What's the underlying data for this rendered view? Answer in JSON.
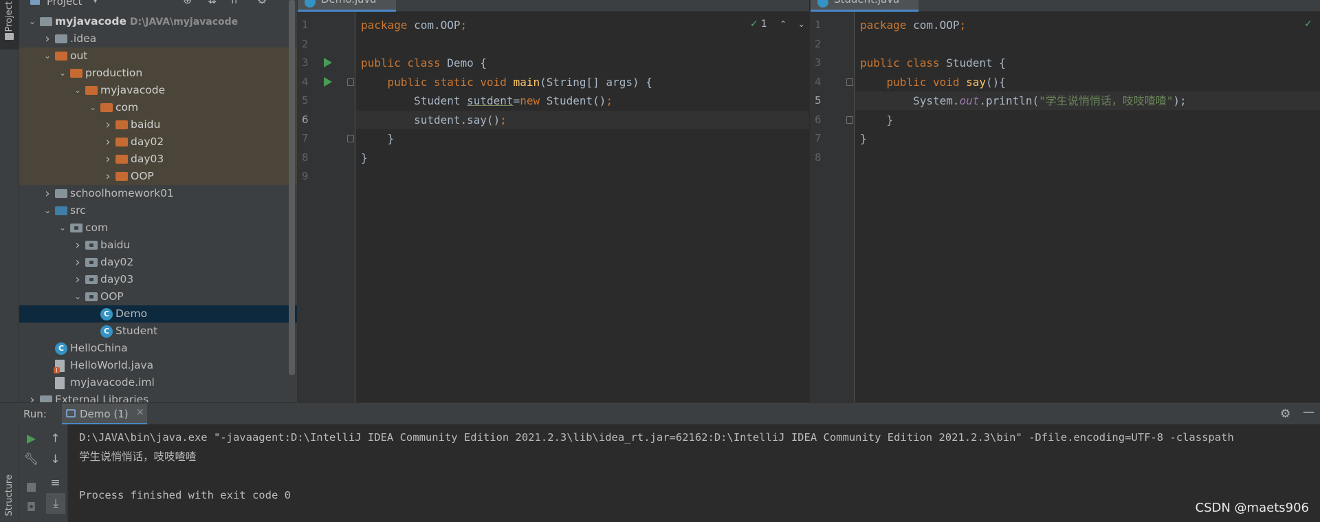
{
  "left_strip": {
    "project_tab": "Project",
    "structure_tab": "Structure"
  },
  "project_panel": {
    "title": "Project",
    "tree": [
      {
        "label": "myjavacode",
        "path": "D:\\JAVA\\myjavacode",
        "kind": "module",
        "state": "expanded",
        "bold": true
      },
      {
        "label": ".idea",
        "kind": "folder-grey",
        "state": "collapsed"
      },
      {
        "label": "out",
        "kind": "folder-orange",
        "state": "expanded"
      },
      {
        "label": "production",
        "kind": "folder-orange",
        "state": "expanded"
      },
      {
        "label": "myjavacode",
        "kind": "folder-orange",
        "state": "expanded"
      },
      {
        "label": "com",
        "kind": "folder-orange",
        "state": "expanded"
      },
      {
        "label": "baidu",
        "kind": "folder-orange",
        "state": "collapsed"
      },
      {
        "label": "day02",
        "kind": "folder-orange",
        "state": "collapsed"
      },
      {
        "label": "day03",
        "kind": "folder-orange",
        "state": "collapsed"
      },
      {
        "label": "OOP",
        "kind": "folder-orange",
        "state": "collapsed"
      },
      {
        "label": "schoolhomework01",
        "kind": "folder-grey",
        "state": "collapsed"
      },
      {
        "label": "src",
        "kind": "folder-blue",
        "state": "expanded"
      },
      {
        "label": "com",
        "kind": "package",
        "state": "expanded"
      },
      {
        "label": "baidu",
        "kind": "package",
        "state": "collapsed"
      },
      {
        "label": "day02",
        "kind": "package",
        "state": "collapsed"
      },
      {
        "label": "day03",
        "kind": "package",
        "state": "collapsed"
      },
      {
        "label": "OOP",
        "kind": "package",
        "state": "expanded"
      },
      {
        "label": "Demo",
        "kind": "class-runnable",
        "selected": true
      },
      {
        "label": "Student",
        "kind": "class"
      },
      {
        "label": "HelloChina",
        "kind": "class-runnable"
      },
      {
        "label": "HelloWorld.java",
        "kind": "java-file"
      },
      {
        "label": "myjavacode.iml",
        "kind": "iml-file"
      },
      {
        "label": "External Libraries",
        "kind": "libraries",
        "state": "collapsed"
      }
    ]
  },
  "editor_left": {
    "tab": "Demo.java",
    "inspection": {
      "count": "1"
    },
    "current_line": 6,
    "line_numbers": [
      "1",
      "2",
      "3",
      "4",
      "5",
      "6",
      "7",
      "8",
      "9"
    ],
    "lines": [
      {
        "parts": [
          {
            "t": "package ",
            "c": "kw"
          },
          {
            "t": "com.OOP",
            "c": ""
          },
          {
            "t": ";",
            "c": "kw"
          }
        ]
      },
      {
        "parts": []
      },
      {
        "parts": [
          {
            "t": "public class ",
            "c": "kw"
          },
          {
            "t": "Demo {",
            "c": ""
          }
        ]
      },
      {
        "parts": [
          {
            "t": "    public static void ",
            "c": "kw"
          },
          {
            "t": "main",
            "c": "fn"
          },
          {
            "t": "(String[] args) {",
            "c": ""
          }
        ]
      },
      {
        "parts": [
          {
            "t": "        Student ",
            "c": ""
          },
          {
            "t": "sutdent",
            "c": "uline"
          },
          {
            "t": "=",
            "c": ""
          },
          {
            "t": "new ",
            "c": "kw"
          },
          {
            "t": "Student()",
            "c": ""
          },
          {
            "t": ";",
            "c": "kw"
          }
        ]
      },
      {
        "parts": [
          {
            "t": "        sutdent.say()",
            "c": ""
          },
          {
            "t": ";",
            "c": "kw"
          }
        ]
      },
      {
        "parts": [
          {
            "t": "    }",
            "c": ""
          }
        ]
      },
      {
        "parts": [
          {
            "t": "}",
            "c": ""
          }
        ]
      },
      {
        "parts": []
      }
    ]
  },
  "editor_right": {
    "tab": "Student.java",
    "current_line": 5,
    "line_numbers": [
      "1",
      "2",
      "3",
      "4",
      "5",
      "6",
      "7",
      "8"
    ],
    "lines": [
      {
        "parts": [
          {
            "t": "package ",
            "c": "kw"
          },
          {
            "t": "com.OOP",
            "c": ""
          },
          {
            "t": ";",
            "c": "kw"
          }
        ]
      },
      {
        "parts": []
      },
      {
        "parts": [
          {
            "t": "public class ",
            "c": "kw"
          },
          {
            "t": "Student {",
            "c": ""
          }
        ]
      },
      {
        "parts": [
          {
            "t": "    public void ",
            "c": "kw"
          },
          {
            "t": "say",
            "c": "fn"
          },
          {
            "t": "(){",
            "c": ""
          }
        ]
      },
      {
        "parts": [
          {
            "t": "        System.",
            "c": ""
          },
          {
            "t": "out",
            "c": "fld"
          },
          {
            "t": ".println(",
            "c": ""
          },
          {
            "t": "\"学生说悄悄话，吱吱喳喳\"",
            "c": "str"
          },
          {
            "t": ");",
            "c": ""
          }
        ]
      },
      {
        "parts": [
          {
            "t": "    }",
            "c": ""
          }
        ]
      },
      {
        "parts": [
          {
            "t": "}",
            "c": ""
          }
        ]
      },
      {
        "parts": []
      }
    ]
  },
  "run_panel": {
    "label": "Run:",
    "tab": "Demo (1)",
    "console": [
      "D:\\JAVA\\bin\\java.exe \"-javaagent:D:\\IntelliJ IDEA Community Edition 2021.2.3\\lib\\idea_rt.jar=62162:D:\\IntelliJ IDEA Community Edition 2021.2.3\\bin\" -Dfile.encoding=UTF-8 -classpath",
      "学生说悄悄话，吱吱喳喳",
      "",
      "Process finished with exit code 0"
    ]
  },
  "watermark": "CSDN @maets906",
  "colors": {
    "accent": "#4a88c7",
    "run_green": "#499c54",
    "selection": "#0d293e",
    "excluded_bg": "#4a4538"
  }
}
